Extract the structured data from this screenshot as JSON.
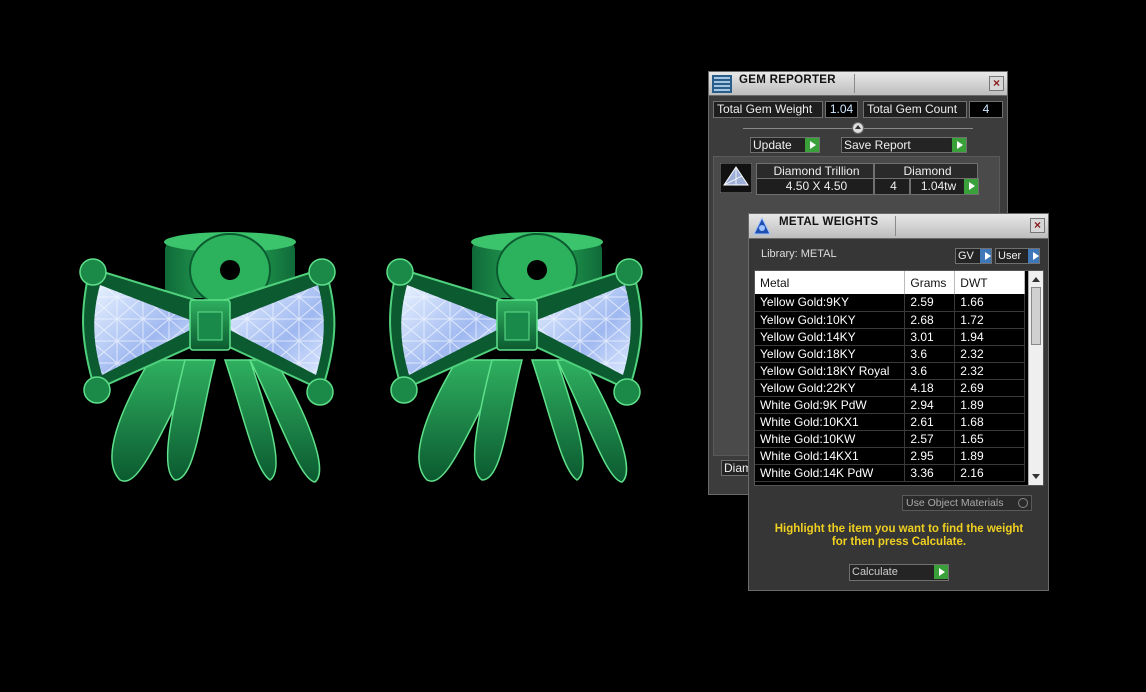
{
  "colors": {
    "accent_green": "#3aa13a",
    "hint_yellow": "#f0d020",
    "gem_blue": "#cfe6ff",
    "jewel_green": "#1a8a4a"
  },
  "gem_reporter": {
    "title": "GEM REPORTER",
    "total_gem_weight_label": "Total Gem Weight",
    "total_gem_weight": "1.04",
    "total_gem_count_label": "Total Gem Count",
    "total_gem_count": "4",
    "update_label": "Update",
    "save_report_label": "Save Report",
    "gem_row": {
      "icon": "trillion-gem-icon",
      "name": "Diamond Trillion",
      "size": "4.50 X 4.50",
      "material": "Diamond",
      "count": "4",
      "weight": "1.04tw"
    },
    "partial_button_label": "Diam"
  },
  "metal_weights": {
    "title": "METAL WEIGHTS",
    "library_label": "Library: METAL",
    "gv_label": "GV",
    "user_label": "User",
    "columns": [
      "Metal",
      "Grams",
      "DWT"
    ],
    "rows": [
      [
        "Yellow Gold:9KY",
        "2.59",
        "1.66"
      ],
      [
        "Yellow Gold:10KY",
        "2.68",
        "1.72"
      ],
      [
        "Yellow Gold:14KY",
        "3.01",
        "1.94"
      ],
      [
        "Yellow Gold:18KY",
        "3.6",
        "2.32"
      ],
      [
        "Yellow Gold:18KY Royal",
        "3.6",
        "2.32"
      ],
      [
        "Yellow Gold:22KY",
        "4.18",
        "2.69"
      ],
      [
        "White Gold:9K PdW",
        "2.94",
        "1.89"
      ],
      [
        "White Gold:10KX1",
        "2.61",
        "1.68"
      ],
      [
        "White Gold:10KW",
        "2.57",
        "1.65"
      ],
      [
        "White Gold:14KX1",
        "2.95",
        "1.89"
      ],
      [
        "White Gold:14K PdW",
        "3.36",
        "2.16"
      ]
    ],
    "use_object_materials_label": "Use Object Materials",
    "hint": "Highlight the item you want to find the weight for then press Calculate.",
    "calculate_label": "Calculate"
  }
}
